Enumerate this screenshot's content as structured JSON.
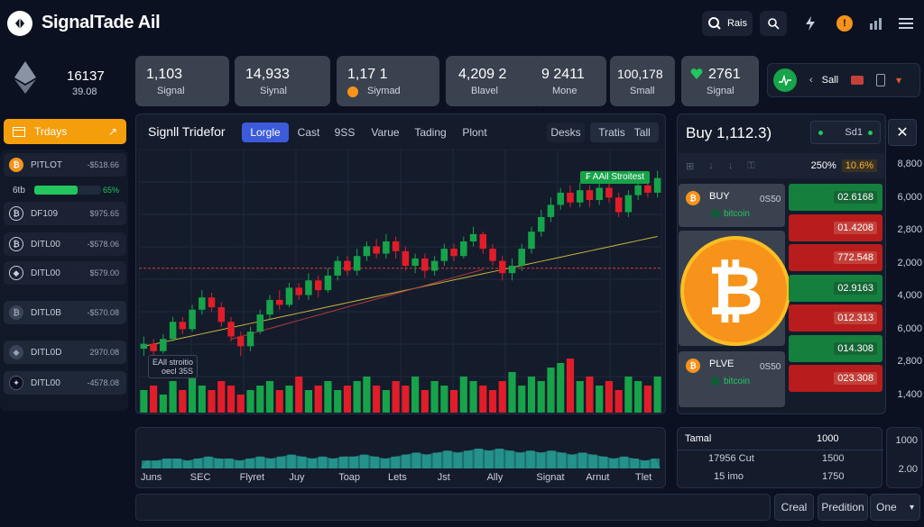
{
  "app": {
    "name": "SignalTade Ail"
  },
  "topbar": {
    "label_button": "Rais"
  },
  "stats": [
    {
      "value": "1,103",
      "label": "Signal"
    },
    {
      "value": "14,933",
      "label": "Siynal"
    },
    {
      "value": "1,17 1",
      "label": "Siymad"
    },
    {
      "value": "4,209 2",
      "label": "Blavel"
    },
    {
      "value": "9 2411",
      "label": "Mone"
    },
    {
      "value": "100,178",
      "label": "Small"
    },
    {
      "value": "2761",
      "label": "Signal"
    }
  ],
  "eth_card": {
    "value": "16137",
    "sub": "39.08"
  },
  "sell_button": "Sall",
  "sidebar": {
    "header": "Trdays",
    "items": [
      {
        "symbol": "PITLOT",
        "price": "-$518.66"
      },
      {
        "symbol": "6tb",
        "price": "65%",
        "progress": 0.65
      },
      {
        "symbol": "DF109",
        "price": "$975.65"
      },
      {
        "symbol": "DITL00",
        "price": "-$578.06"
      },
      {
        "symbol": "DITL00",
        "price": "$579.00"
      },
      {
        "symbol": "DITL0B",
        "price": "-$570.08"
      },
      {
        "symbol": "DITL0D",
        "price": "2970.08"
      },
      {
        "symbol": "DITL00",
        "price": "-4578.08"
      }
    ]
  },
  "chart_panel": {
    "title": "Signll Tridefor",
    "tabs": [
      "Lorgle",
      "Cast",
      "9SS",
      "Varue",
      "Tading",
      "Plont"
    ],
    "right_tabs": [
      "Desks",
      "Tratis",
      "Tall"
    ],
    "signal_tag": "₣ AAil Stroitest",
    "annotation_line1": "EAll stroitio",
    "annotation_line2": "oecl 35S"
  },
  "chart_data": {
    "type": "candlestick",
    "title": "Signll Tridefor",
    "price_axis_labels": [
      "8,800",
      "6,000",
      "2,800",
      "2,000",
      "4,000",
      "6,000",
      "2,800",
      "1,400"
    ],
    "candles": [
      {
        "o": 2.2,
        "c": 2.4,
        "h": 2.7,
        "l": 1.9
      },
      {
        "o": 2.4,
        "c": 2.1,
        "h": 2.6,
        "l": 1.9
      },
      {
        "o": 2.1,
        "c": 2.6,
        "h": 2.8,
        "l": 2.0
      },
      {
        "o": 2.6,
        "c": 3.3,
        "h": 3.5,
        "l": 2.5
      },
      {
        "o": 3.3,
        "c": 3.0,
        "h": 3.5,
        "l": 2.8
      },
      {
        "o": 3.0,
        "c": 3.8,
        "h": 4.0,
        "l": 2.9
      },
      {
        "o": 3.8,
        "c": 4.3,
        "h": 4.6,
        "l": 3.6
      },
      {
        "o": 4.3,
        "c": 3.9,
        "h": 4.5,
        "l": 3.7
      },
      {
        "o": 3.9,
        "c": 3.3,
        "h": 4.1,
        "l": 3.1
      },
      {
        "o": 3.3,
        "c": 2.7,
        "h": 3.5,
        "l": 2.5
      },
      {
        "o": 2.7,
        "c": 2.3,
        "h": 2.9,
        "l": 1.9
      },
      {
        "o": 2.3,
        "c": 2.9,
        "h": 3.1,
        "l": 2.1
      },
      {
        "o": 2.9,
        "c": 3.6,
        "h": 3.8,
        "l": 2.8
      },
      {
        "o": 3.6,
        "c": 4.2,
        "h": 4.4,
        "l": 3.4
      },
      {
        "o": 4.2,
        "c": 4.0,
        "h": 4.6,
        "l": 3.8
      },
      {
        "o": 4.0,
        "c": 4.7,
        "h": 4.9,
        "l": 3.9
      },
      {
        "o": 4.7,
        "c": 4.4,
        "h": 4.9,
        "l": 4.2
      },
      {
        "o": 4.4,
        "c": 5.0,
        "h": 5.3,
        "l": 4.2
      },
      {
        "o": 5.0,
        "c": 4.6,
        "h": 5.2,
        "l": 4.3
      },
      {
        "o": 4.6,
        "c": 5.2,
        "h": 5.5,
        "l": 4.5
      },
      {
        "o": 5.2,
        "c": 5.8,
        "h": 6.0,
        "l": 5.0
      },
      {
        "o": 5.8,
        "c": 5.4,
        "h": 6.0,
        "l": 5.2
      },
      {
        "o": 5.4,
        "c": 6.0,
        "h": 6.3,
        "l": 5.2
      },
      {
        "o": 6.0,
        "c": 6.4,
        "h": 6.6,
        "l": 5.8
      },
      {
        "o": 6.4,
        "c": 6.1,
        "h": 6.7,
        "l": 5.9
      },
      {
        "o": 6.1,
        "c": 6.6,
        "h": 6.9,
        "l": 5.9
      },
      {
        "o": 6.6,
        "c": 6.2,
        "h": 6.8,
        "l": 5.9
      },
      {
        "o": 6.2,
        "c": 5.6,
        "h": 6.4,
        "l": 5.4
      },
      {
        "o": 5.6,
        "c": 5.9,
        "h": 6.1,
        "l": 5.3
      },
      {
        "o": 5.9,
        "c": 5.4,
        "h": 6.1,
        "l": 5.1
      },
      {
        "o": 5.4,
        "c": 5.8,
        "h": 6.0,
        "l": 5.2
      },
      {
        "o": 5.8,
        "c": 6.3,
        "h": 6.5,
        "l": 5.6
      },
      {
        "o": 6.3,
        "c": 6.0,
        "h": 6.5,
        "l": 5.8
      },
      {
        "o": 6.0,
        "c": 6.6,
        "h": 6.8,
        "l": 5.9
      },
      {
        "o": 6.6,
        "c": 6.9,
        "h": 7.2,
        "l": 6.4
      },
      {
        "o": 6.9,
        "c": 6.3,
        "h": 7.0,
        "l": 6.1
      },
      {
        "o": 6.3,
        "c": 5.8,
        "h": 6.5,
        "l": 5.6
      },
      {
        "o": 5.8,
        "c": 5.3,
        "h": 6.0,
        "l": 5.0
      },
      {
        "o": 5.3,
        "c": 5.6,
        "h": 5.9,
        "l": 5.0
      },
      {
        "o": 5.6,
        "c": 6.3,
        "h": 6.5,
        "l": 5.4
      },
      {
        "o": 6.3,
        "c": 7.0,
        "h": 7.2,
        "l": 6.1
      },
      {
        "o": 7.0,
        "c": 7.6,
        "h": 7.9,
        "l": 6.8
      },
      {
        "o": 7.6,
        "c": 8.1,
        "h": 8.4,
        "l": 7.4
      },
      {
        "o": 8.1,
        "c": 8.6,
        "h": 8.8,
        "l": 7.9
      },
      {
        "o": 8.6,
        "c": 8.2,
        "h": 8.9,
        "l": 8.0
      },
      {
        "o": 8.2,
        "c": 8.7,
        "h": 9.0,
        "l": 8.0
      },
      {
        "o": 8.7,
        "c": 8.3,
        "h": 8.9,
        "l": 8.0
      },
      {
        "o": 8.3,
        "c": 8.8,
        "h": 9.0,
        "l": 8.1
      },
      {
        "o": 8.8,
        "c": 8.4,
        "h": 9.0,
        "l": 8.2
      },
      {
        "o": 8.4,
        "c": 7.8,
        "h": 8.6,
        "l": 7.6
      },
      {
        "o": 7.8,
        "c": 8.5,
        "h": 8.7,
        "l": 7.6
      },
      {
        "o": 8.5,
        "c": 8.9,
        "h": 9.2,
        "l": 8.3
      },
      {
        "o": 8.9,
        "c": 8.6,
        "h": 9.3,
        "l": 8.4
      },
      {
        "o": 8.6,
        "c": 9.2,
        "h": 9.5,
        "l": 8.4
      }
    ],
    "volumes": [
      3,
      4,
      2,
      5,
      3,
      6,
      4,
      3,
      5,
      4,
      2,
      3,
      4,
      5,
      3,
      4,
      6,
      3,
      4,
      5,
      3,
      4,
      5,
      6,
      4,
      3,
      5,
      4,
      6,
      3,
      5,
      4,
      3,
      6,
      5,
      4,
      3,
      5,
      7,
      4,
      6,
      5,
      8,
      9,
      10,
      5,
      6,
      4,
      5,
      3,
      6,
      5,
      4,
      6,
      5
    ],
    "time_labels": [
      "Juns",
      "SEC",
      "Flyret",
      "Juy",
      "Toap",
      "Lets",
      "Jst",
      "Ally",
      "Signat",
      "Arnut",
      "Tlet"
    ],
    "overview": [
      4,
      4,
      5,
      5,
      4,
      5,
      6,
      5,
      5,
      4,
      5,
      6,
      5,
      6,
      7,
      6,
      5,
      6,
      5,
      6,
      6,
      7,
      6,
      5,
      6,
      7,
      8,
      7,
      8,
      9,
      8,
      9,
      10,
      9,
      10,
      9,
      8,
      9,
      8,
      9,
      8,
      7,
      8,
      7,
      6,
      5,
      6,
      5,
      4,
      5
    ],
    "colors": {
      "up": "#17a34a",
      "down": "#e11d2a",
      "ma1": "#c9b43a",
      "ma2": "#b33a3a",
      "support": "#d33a3a"
    }
  },
  "orderbook": {
    "title": "Buy 1,112.3)",
    "sell_label": "Sd1",
    "pct_a": "250%",
    "pct_b": "10.6%",
    "buy_entry": {
      "side": "BUY",
      "coin": "bitcoin",
      "qty": "0S50"
    },
    "plve_entry": {
      "side": "PLVE",
      "coin": "bitcoin",
      "qty": "0S50"
    },
    "rows": [
      {
        "value": "02.6168",
        "kind": "buy"
      },
      {
        "value": "01.4208",
        "kind": "sell"
      },
      {
        "value": "772.548",
        "kind": "sell"
      },
      {
        "value": "02.9163",
        "kind": "buy"
      },
      {
        "value": "012.313",
        "kind": "sell"
      },
      {
        "value": "014.308",
        "kind": "buy"
      },
      {
        "value": "023.308",
        "kind": "sell"
      }
    ],
    "axis": [
      "8,800",
      "6,000",
      "2,800",
      "2,000",
      "4,000",
      "6,000",
      "2,800",
      "1,400"
    ]
  },
  "summary": {
    "rows": [
      {
        "label": "Tamal",
        "value": "1000"
      },
      {
        "label": "17956 Cut",
        "value": "1500"
      },
      {
        "label": "15 imo",
        "value": "1750"
      }
    ],
    "axis": [
      "1000",
      "2.00"
    ]
  },
  "bottom": {
    "btn1": "Creal",
    "btn2": "Predition",
    "select": "One"
  }
}
